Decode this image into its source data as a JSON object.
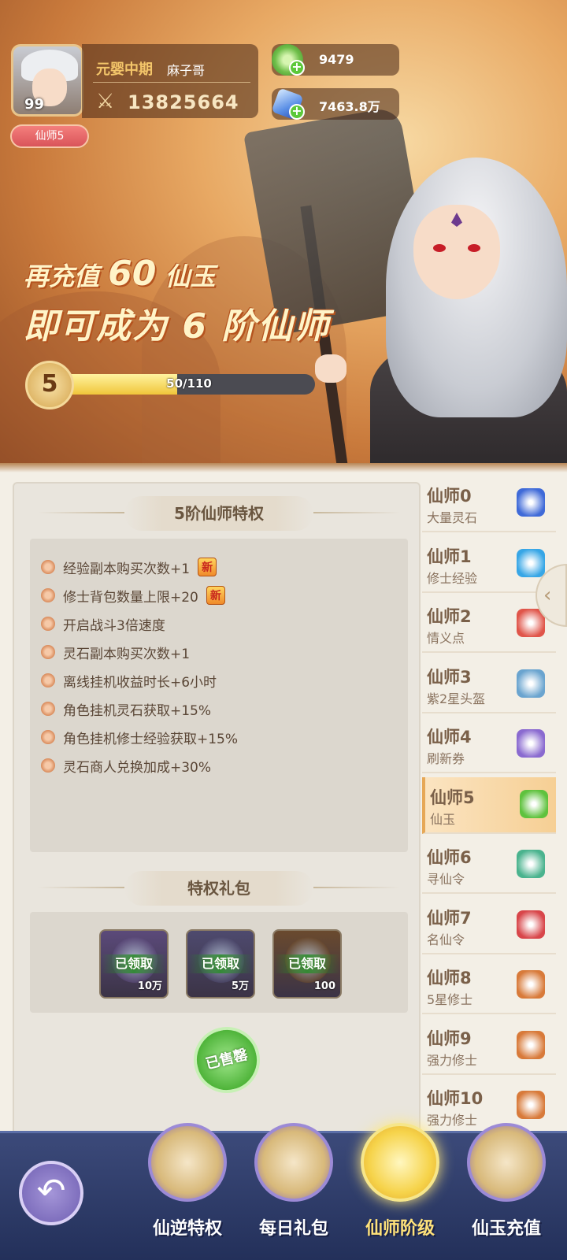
{
  "profile": {
    "level": "99",
    "realm": "元婴中期",
    "name": "麻子哥",
    "power": "13825664",
    "vip_tag": "仙师5"
  },
  "currencies": [
    {
      "value": "9479",
      "icon": "jade-icon",
      "color": "#6fbf4a"
    },
    {
      "value": "7463.8万",
      "icon": "crystal-icon",
      "color": "#5a8fe6"
    }
  ],
  "promo": {
    "line1_a": "再充值",
    "line1_num": "60",
    "line1_b": "仙玉",
    "line2": "即可成为 6 阶仙师"
  },
  "progress": {
    "level": "5",
    "text": "50/110",
    "fraction": 0.4545
  },
  "privileges": {
    "title": "5阶仙师特权",
    "new_label": "新",
    "items": [
      {
        "text": "经验副本购买次数+1",
        "is_new": true
      },
      {
        "text": "修士背包数量上限+20",
        "is_new": true
      },
      {
        "text": "开启战斗3倍速度",
        "is_new": false
      },
      {
        "text": "灵石副本购买次数+1",
        "is_new": false
      },
      {
        "text": "离线挂机收益时长+6小时",
        "is_new": false
      },
      {
        "text": "角色挂机灵石获取+15%",
        "is_new": false
      },
      {
        "text": "角色挂机修士经验获取+15%",
        "is_new": false
      },
      {
        "text": "灵石商人兑换加成+30%",
        "is_new": false
      }
    ]
  },
  "gift_pack": {
    "title": "特权礼包",
    "claimed_label": "已领取",
    "items": [
      {
        "qty": "10万",
        "icon": "crystal-icon",
        "color": "#5b4a7a"
      },
      {
        "qty": "5万",
        "icon": "orb-icon",
        "color": "#4e4a6e"
      },
      {
        "qty": "100",
        "icon": "jade-icon",
        "color": "#6a4a2e"
      }
    ],
    "sold_out": "已售罄"
  },
  "vip_levels": [
    {
      "name": "仙师0",
      "desc": "大量灵石",
      "icon": "crystal-icon",
      "color": "#3f6ad8"
    },
    {
      "name": "仙师1",
      "desc": "修士经验",
      "icon": "orb-icon",
      "color": "#37a6e6"
    },
    {
      "name": "仙师2",
      "desc": "情义点",
      "icon": "heart-icon",
      "color": "#e0554a"
    },
    {
      "name": "仙师3",
      "desc": "紫2星头盔",
      "icon": "armor-icon",
      "color": "#6aa4cf"
    },
    {
      "name": "仙师4",
      "desc": "刷新券",
      "icon": "scroll-icon",
      "color": "#8a6ad0"
    },
    {
      "name": "仙师5",
      "desc": "仙玉",
      "icon": "jade-icon",
      "color": "#5fc23e",
      "active": true
    },
    {
      "name": "仙师6",
      "desc": "寻仙令",
      "icon": "token-icon",
      "color": "#4ab38e"
    },
    {
      "name": "仙师7",
      "desc": "名仙令",
      "icon": "token-icon",
      "color": "#d8464a"
    },
    {
      "name": "仙师8",
      "desc": "5星修士",
      "icon": "chest-icon",
      "color": "#d87a3a"
    },
    {
      "name": "仙师9",
      "desc": "强力修士",
      "icon": "chest-icon",
      "color": "#d87a3a"
    },
    {
      "name": "仙师10",
      "desc": "强力修士",
      "icon": "chest-icon",
      "color": "#d87a3a"
    }
  ],
  "tabs": [
    {
      "label": "仙逆特权",
      "icon": "privilege-icon"
    },
    {
      "label": "每日礼包",
      "icon": "daily-gift-icon"
    },
    {
      "label": "仙师阶级",
      "icon": "vip-rank-icon",
      "active": true
    },
    {
      "label": "仙玉充值",
      "icon": "recharge-icon"
    }
  ]
}
